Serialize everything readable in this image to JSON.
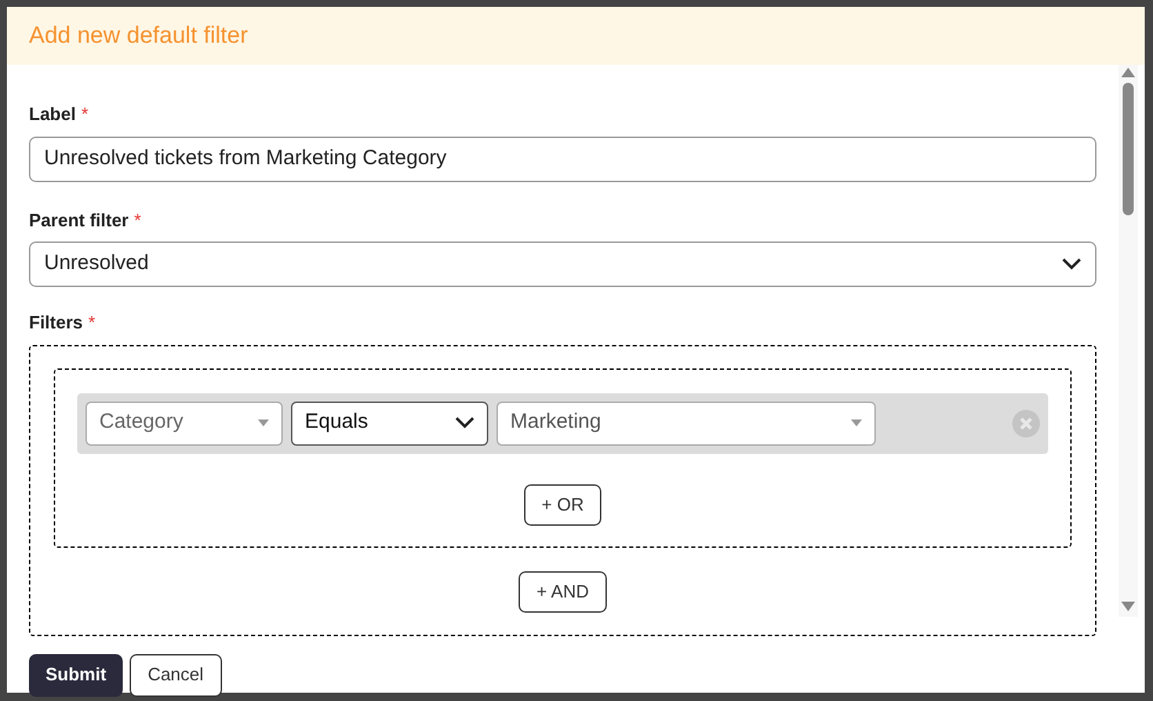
{
  "dialog": {
    "title": "Add new default filter"
  },
  "label_field": {
    "label": "Label",
    "required_mark": "*",
    "value": "Unresolved tickets from Marketing Category"
  },
  "parent_filter": {
    "label": "Parent filter",
    "required_mark": "*",
    "value": "Unresolved"
  },
  "filters": {
    "label": "Filters",
    "required_mark": "*",
    "groups": [
      {
        "conditions": [
          {
            "field": "Category",
            "operator": "Equals",
            "value": "Marketing"
          }
        ],
        "or_button": "+ OR"
      }
    ],
    "and_button": "+ AND"
  },
  "buttons": [
    {
      "label": "Submit",
      "kind": "primary"
    },
    {
      "label": "Cancel",
      "kind": "secondary"
    }
  ]
}
